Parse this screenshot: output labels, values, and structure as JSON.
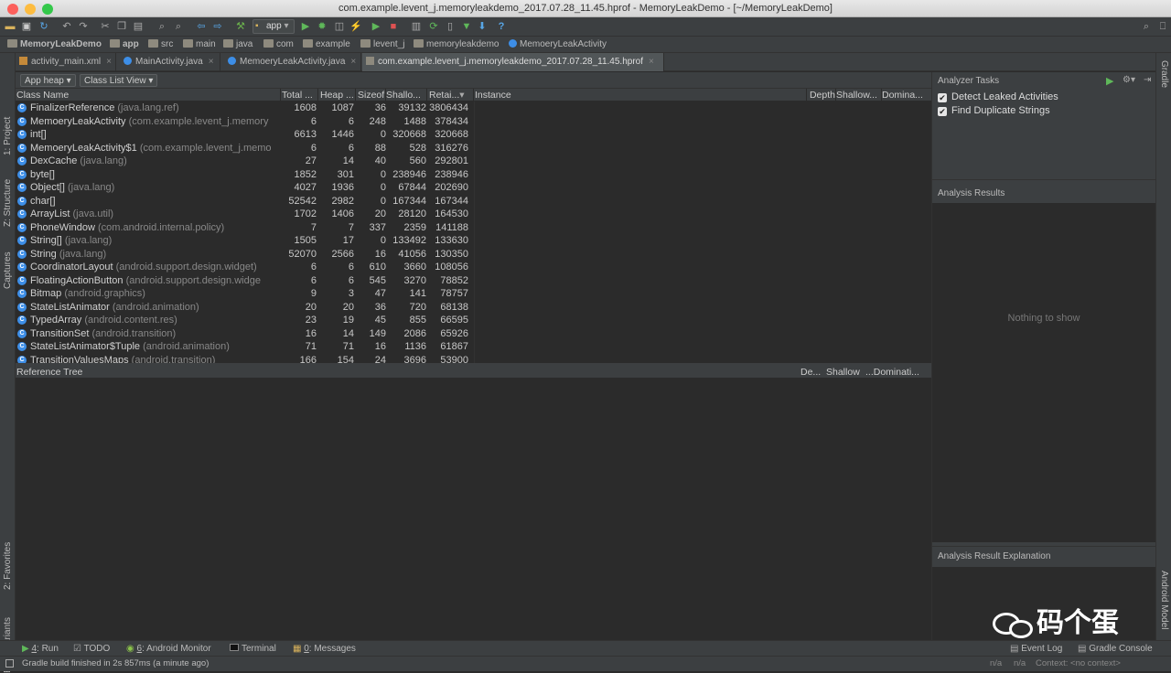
{
  "window": {
    "title": "com.example.levent_j.memoryleakdemo_2017.07.28_11.45.hprof - MemoryLeakDemo - [~/MemoryLeakDemo]"
  },
  "toolbar": {
    "run_config": "app",
    "help": "?"
  },
  "breadcrumb": [
    "MemoryLeakDemo",
    "app",
    "src",
    "main",
    "java",
    "com",
    "example",
    "levent_j",
    "memoryleakdemo",
    "MemoeryLeakActivity"
  ],
  "tabs": [
    {
      "label": "activity_main.xml"
    },
    {
      "label": "MainActivity.java"
    },
    {
      "label": "MemoeryLeakActivity.java"
    },
    {
      "label": "com.example.levent_j.memoryleakdemo_2017.07.28_11.45.hprof"
    }
  ],
  "tab_close": "×",
  "left_strip": [
    "1: Project",
    "Z: Structure",
    "Captures",
    "2: Favorites",
    "Build Variants"
  ],
  "right_strip": [
    "Gradle",
    "Android Model"
  ],
  "heap": {
    "heap_select": "App heap",
    "view_select": "Class List View"
  },
  "columns": {
    "class_name": "Class Name",
    "total": "Total ...",
    "heap": "Heap ...",
    "sizeof": "Sizeof",
    "shallow": "Shallo...",
    "retained": "Retai...",
    "instance": "Instance",
    "depth": "Depth",
    "inst_shallow": "Shallow...",
    "dominating": "Domina..."
  },
  "rows": [
    {
      "name": "FinalizerReference",
      "pkg": "(java.lang.ref)",
      "total": "1608",
      "heap": "1087",
      "sizeof": "36",
      "shallow": "39132",
      "retained": "3806434"
    },
    {
      "name": "MemoeryLeakActivity",
      "pkg": "(com.example.levent_j.memory",
      "total": "6",
      "heap": "6",
      "sizeof": "248",
      "shallow": "1488",
      "retained": "378434"
    },
    {
      "name": "int[]",
      "pkg": "",
      "total": "6613",
      "heap": "1446",
      "sizeof": "0",
      "shallow": "320668",
      "retained": "320668"
    },
    {
      "name": "MemoeryLeakActivity$1",
      "pkg": "(com.example.levent_j.memo",
      "total": "6",
      "heap": "6",
      "sizeof": "88",
      "shallow": "528",
      "retained": "316276"
    },
    {
      "name": "DexCache",
      "pkg": "(java.lang)",
      "total": "27",
      "heap": "14",
      "sizeof": "40",
      "shallow": "560",
      "retained": "292801"
    },
    {
      "name": "byte[]",
      "pkg": "",
      "total": "1852",
      "heap": "301",
      "sizeof": "0",
      "shallow": "238946",
      "retained": "238946"
    },
    {
      "name": "Object[]",
      "pkg": "(java.lang)",
      "total": "4027",
      "heap": "1936",
      "sizeof": "0",
      "shallow": "67844",
      "retained": "202690"
    },
    {
      "name": "char[]",
      "pkg": "",
      "total": "52542",
      "heap": "2982",
      "sizeof": "0",
      "shallow": "167344",
      "retained": "167344"
    },
    {
      "name": "ArrayList",
      "pkg": "(java.util)",
      "total": "1702",
      "heap": "1406",
      "sizeof": "20",
      "shallow": "28120",
      "retained": "164530"
    },
    {
      "name": "PhoneWindow",
      "pkg": "(com.android.internal.policy)",
      "total": "7",
      "heap": "7",
      "sizeof": "337",
      "shallow": "2359",
      "retained": "141188"
    },
    {
      "name": "String[]",
      "pkg": "(java.lang)",
      "total": "1505",
      "heap": "17",
      "sizeof": "0",
      "shallow": "133492",
      "retained": "133630"
    },
    {
      "name": "String",
      "pkg": "(java.lang)",
      "total": "52070",
      "heap": "2566",
      "sizeof": "16",
      "shallow": "41056",
      "retained": "130350"
    },
    {
      "name": "CoordinatorLayout",
      "pkg": "(android.support.design.widget)",
      "total": "6",
      "heap": "6",
      "sizeof": "610",
      "shallow": "3660",
      "retained": "108056"
    },
    {
      "name": "FloatingActionButton",
      "pkg": "(android.support.design.widge",
      "total": "6",
      "heap": "6",
      "sizeof": "545",
      "shallow": "3270",
      "retained": "78852"
    },
    {
      "name": "Bitmap",
      "pkg": "(android.graphics)",
      "total": "9",
      "heap": "3",
      "sizeof": "47",
      "shallow": "141",
      "retained": "78757"
    },
    {
      "name": "StateListAnimator",
      "pkg": "(android.animation)",
      "total": "20",
      "heap": "20",
      "sizeof": "36",
      "shallow": "720",
      "retained": "68138"
    },
    {
      "name": "TypedArray",
      "pkg": "(android.content.res)",
      "total": "23",
      "heap": "19",
      "sizeof": "45",
      "shallow": "855",
      "retained": "66595"
    },
    {
      "name": "TransitionSet",
      "pkg": "(android.transition)",
      "total": "16",
      "heap": "14",
      "sizeof": "149",
      "shallow": "2086",
      "retained": "65926"
    },
    {
      "name": "StateListAnimator$Tuple",
      "pkg": "(android.animation)",
      "total": "71",
      "heap": "71",
      "sizeof": "16",
      "shallow": "1136",
      "retained": "61867"
    },
    {
      "name": "TransitionValuesMaps",
      "pkg": "(android.transition)",
      "total": "166",
      "heap": "154",
      "sizeof": "24",
      "shallow": "3696",
      "retained": "53900"
    }
  ],
  "reference_tree": {
    "title": "Reference Tree",
    "depth": "De...",
    "shallow": "Shallow",
    "dominating": "...Dominati..."
  },
  "analyzer": {
    "tasks_title": "Analyzer Tasks",
    "tasks": [
      {
        "label": "Detect Leaked Activities",
        "checked": true
      },
      {
        "label": "Find Duplicate Strings",
        "checked": true
      }
    ],
    "results_title": "Analysis Results",
    "empty": "Nothing to show",
    "explanation_title": "Analysis Result Explanation"
  },
  "bottom_tools": [
    {
      "num": "4",
      "label": ": Run"
    },
    {
      "num": "",
      "label": "TODO"
    },
    {
      "num": "6",
      "label": ": Android Monitor"
    },
    {
      "num": "",
      "label": "Terminal"
    },
    {
      "num": "0",
      "label": ": Messages"
    }
  ],
  "bottom_right": {
    "event_log": "Event Log",
    "gradle_console": "Gradle Console"
  },
  "status": {
    "message": "Gradle build finished in 2s 857ms (a minute ago)",
    "na1": "n/a",
    "na2": "n/a",
    "context": "Context: <no context>"
  },
  "watermark": "码个蛋"
}
